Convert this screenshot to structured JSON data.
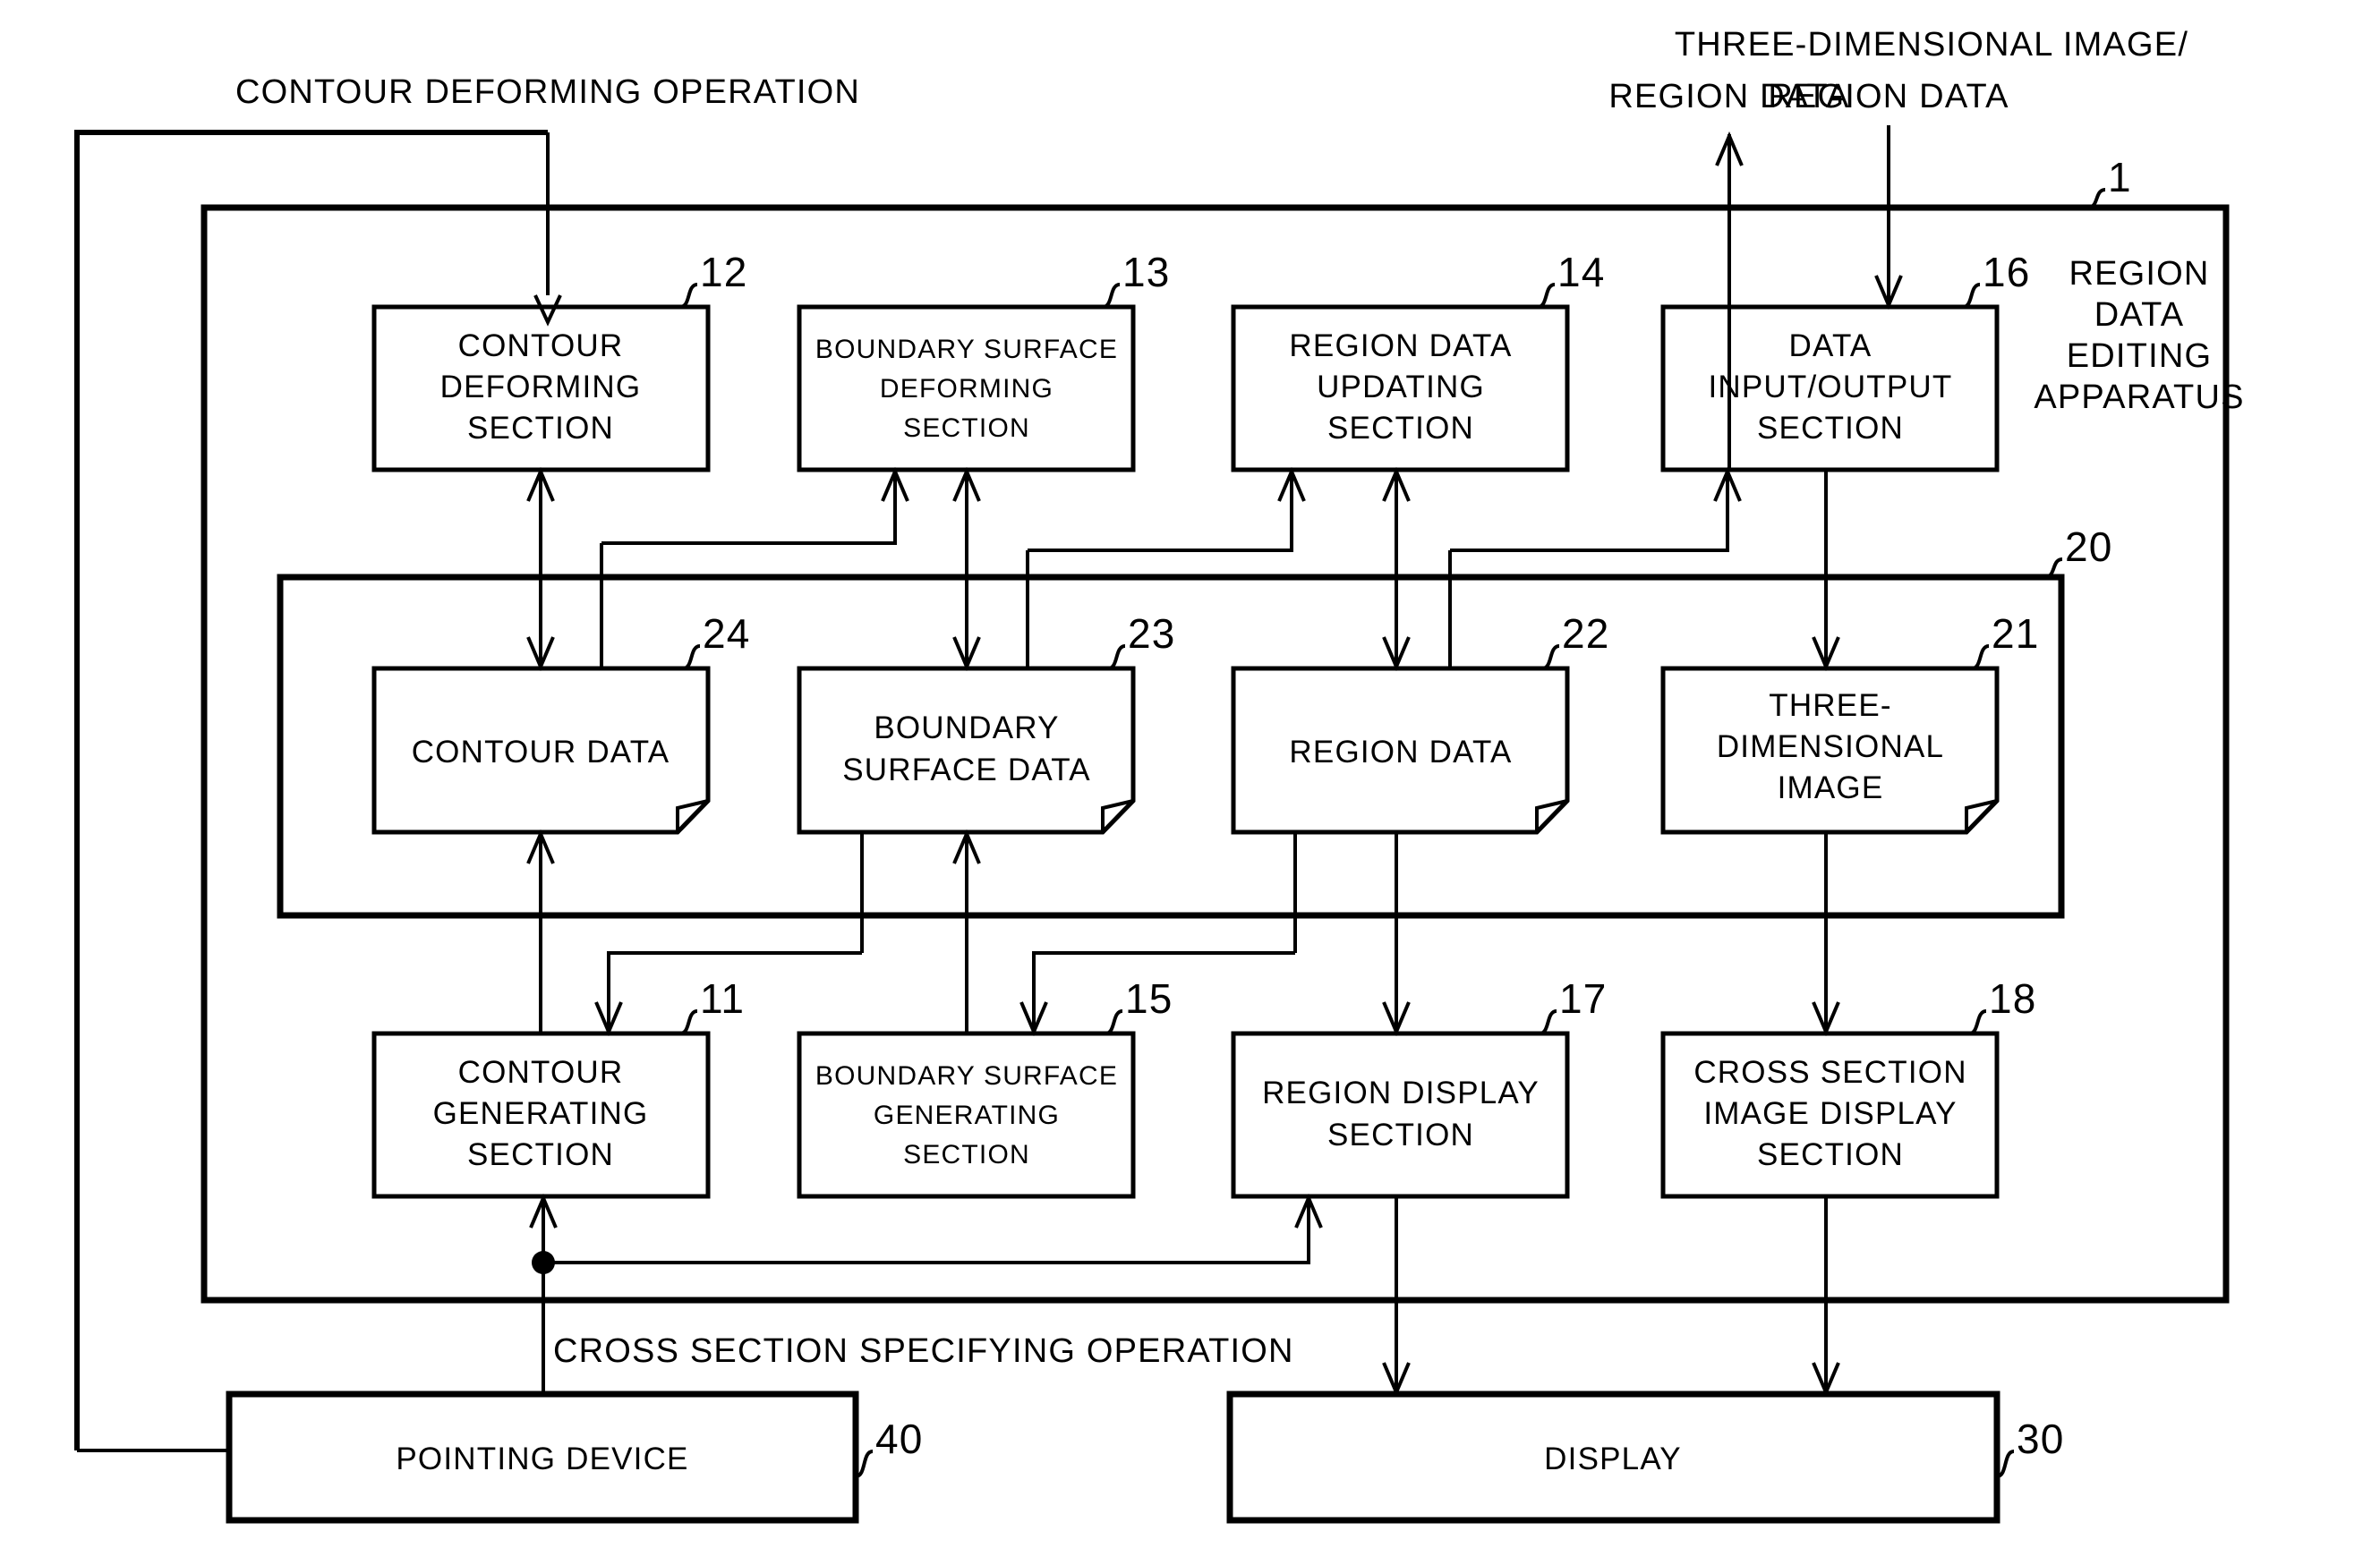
{
  "figure": {
    "apparatus_label_lines": [
      "REGION",
      "DATA",
      "EDITING",
      "APPARATUS"
    ],
    "apparatus_ref": "1",
    "storage_ref": "20"
  },
  "external_labels": [
    {
      "id": "contour-deforming-operation",
      "text": "CONTOUR DEFORMING OPERATION"
    },
    {
      "id": "region-data-out",
      "text": "REGION DATA"
    },
    {
      "id": "three-dimensional-image-region-data-line1",
      "text": "THREE-DIMENSIONAL IMAGE/"
    },
    {
      "id": "three-dimensional-image-region-data-line2",
      "text": "REGION DATA"
    },
    {
      "id": "cross-section-specifying-operation",
      "text": "CROSS SECTION SPECIFYING OPERATION"
    }
  ],
  "blocks": {
    "row1": [
      {
        "ref": "12",
        "lines": [
          "CONTOUR",
          "DEFORMING",
          "SECTION"
        ],
        "name": "contour-deforming-section"
      },
      {
        "ref": "13",
        "lines": [
          "BOUNDARY SURFACE",
          "DEFORMING",
          "SECTION"
        ],
        "name": "boundary-surface-deforming-section"
      },
      {
        "ref": "14",
        "lines": [
          "REGION DATA",
          "UPDATING",
          "SECTION"
        ],
        "name": "region-data-updating-section"
      },
      {
        "ref": "16",
        "lines": [
          "DATA",
          "INPUT/OUTPUT",
          "SECTION"
        ],
        "name": "data-input-output-section"
      }
    ],
    "row2": [
      {
        "ref": "24",
        "lines": [
          "CONTOUR DATA"
        ],
        "name": "contour-data"
      },
      {
        "ref": "23",
        "lines": [
          "BOUNDARY",
          "SURFACE DATA"
        ],
        "name": "boundary-surface-data"
      },
      {
        "ref": "22",
        "lines": [
          "REGION DATA"
        ],
        "name": "region-data"
      },
      {
        "ref": "21",
        "lines": [
          "THREE-",
          "DIMENSIONAL",
          "IMAGE"
        ],
        "name": "three-dimensional-image"
      }
    ],
    "row3": [
      {
        "ref": "11",
        "lines": [
          "CONTOUR",
          "GENERATING",
          "SECTION"
        ],
        "name": "contour-generating-section"
      },
      {
        "ref": "15",
        "lines": [
          "BOUNDARY SURFACE",
          "GENERATING",
          "SECTION"
        ],
        "name": "boundary-surface-generating-section"
      },
      {
        "ref": "17",
        "lines": [
          "REGION DISPLAY",
          "SECTION"
        ],
        "name": "region-display-section"
      },
      {
        "ref": "18",
        "lines": [
          "CROSS SECTION",
          "IMAGE DISPLAY",
          "SECTION"
        ],
        "name": "cross-section-image-display-section"
      }
    ],
    "row4": [
      {
        "ref": "40",
        "lines": [
          "POINTING DEVICE"
        ],
        "name": "pointing-device"
      },
      {
        "ref": "30",
        "lines": [
          "DISPLAY"
        ],
        "name": "display"
      }
    ]
  },
  "colors": {
    "line": "#000000",
    "background": "#ffffff"
  }
}
